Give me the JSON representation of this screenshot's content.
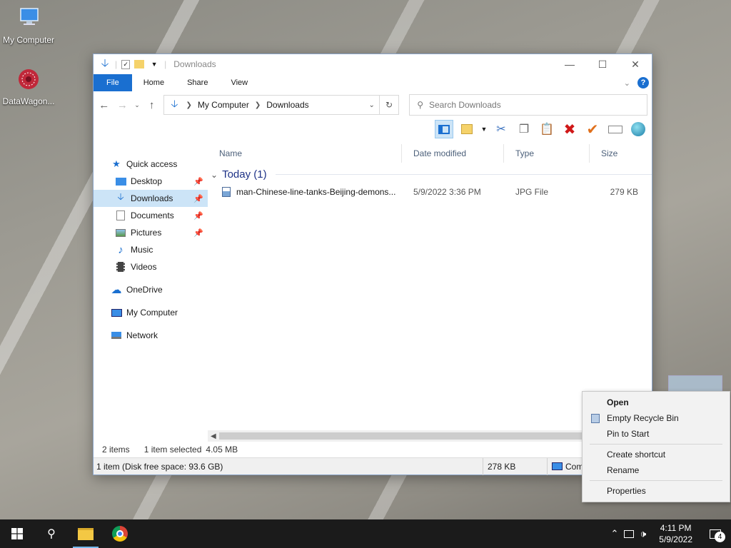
{
  "desktop": {
    "icons": [
      {
        "label": "My Computer",
        "icon": "monitor-icon"
      },
      {
        "label": "DataWagon...",
        "icon": "datawagon-logo-icon"
      }
    ]
  },
  "window": {
    "title": "Downloads",
    "ribbon_tabs": [
      "File",
      "Home",
      "Share",
      "View"
    ],
    "breadcrumb": [
      "My Computer",
      "Downloads"
    ],
    "search_placeholder": "Search Downloads",
    "nav_pane": {
      "quick_access": "Quick access",
      "items": [
        {
          "label": "Desktop",
          "pinned": true
        },
        {
          "label": "Downloads",
          "pinned": true,
          "selected": true
        },
        {
          "label": "Documents",
          "pinned": true
        },
        {
          "label": "Pictures",
          "pinned": true
        },
        {
          "label": "Music",
          "pinned": false
        },
        {
          "label": "Videos",
          "pinned": false
        }
      ],
      "onedrive": "OneDrive",
      "my_computer": "My Computer",
      "network": "Network"
    },
    "columns": [
      "Name",
      "Date modified",
      "Type",
      "Size"
    ],
    "group_label": "Today (1)",
    "files": [
      {
        "name": "man-Chinese-line-tanks-Beijing-demons...",
        "date": "5/9/2022 3:36 PM",
        "type": "JPG File",
        "size": "279 KB"
      }
    ],
    "status": {
      "items": "2 items",
      "selected": "1 item selected",
      "selected_size": "4.05 MB",
      "details": "1 item (Disk free space: 93.6 GB)",
      "details_size": "278 KB",
      "location": "Com"
    }
  },
  "context_menu": {
    "items": [
      {
        "label": "Open",
        "bold": true
      },
      {
        "label": "Empty Recycle Bin",
        "icon": "recycle-bin-shield-icon"
      },
      {
        "label": "Pin to Start"
      },
      {
        "separator": true
      },
      {
        "label": "Create shortcut"
      },
      {
        "label": "Rename"
      },
      {
        "separator": true
      },
      {
        "label": "Properties"
      }
    ]
  },
  "taskbar": {
    "time": "4:11 PM",
    "date": "5/9/2022",
    "notification_count": "4"
  },
  "colors": {
    "accent": "#1a6fd0",
    "selection": "#cce4f7",
    "taskbar": "#1b1b1b"
  }
}
